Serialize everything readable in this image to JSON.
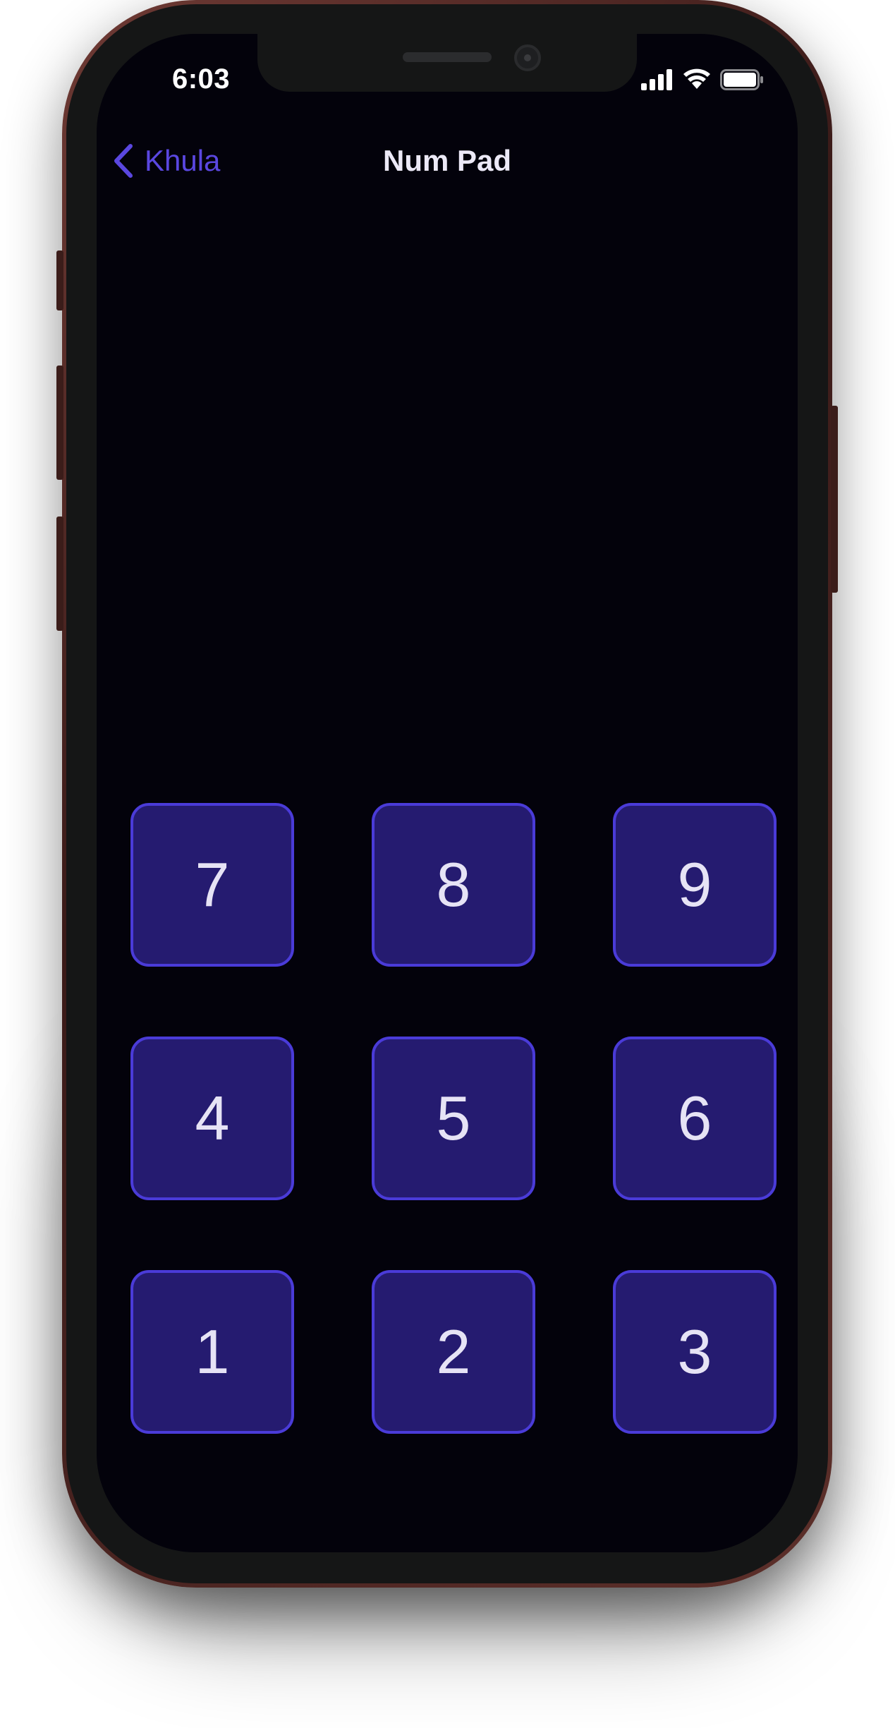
{
  "status_bar": {
    "time": "6:03"
  },
  "nav": {
    "back_label": "Khula",
    "title": "Num Pad"
  },
  "keypad": {
    "keys": [
      "7",
      "8",
      "9",
      "4",
      "5",
      "6",
      "1",
      "2",
      "3"
    ]
  },
  "colors": {
    "screen_background": "#03020b",
    "key_fill": "#251b70",
    "key_border": "#4a3bd8",
    "accent": "#5a47e0",
    "text": "#e6e3f5"
  },
  "icons": {
    "back": "chevron-left-icon",
    "signal": "cellular-signal-icon",
    "wifi": "wifi-icon",
    "battery": "battery-icon"
  }
}
